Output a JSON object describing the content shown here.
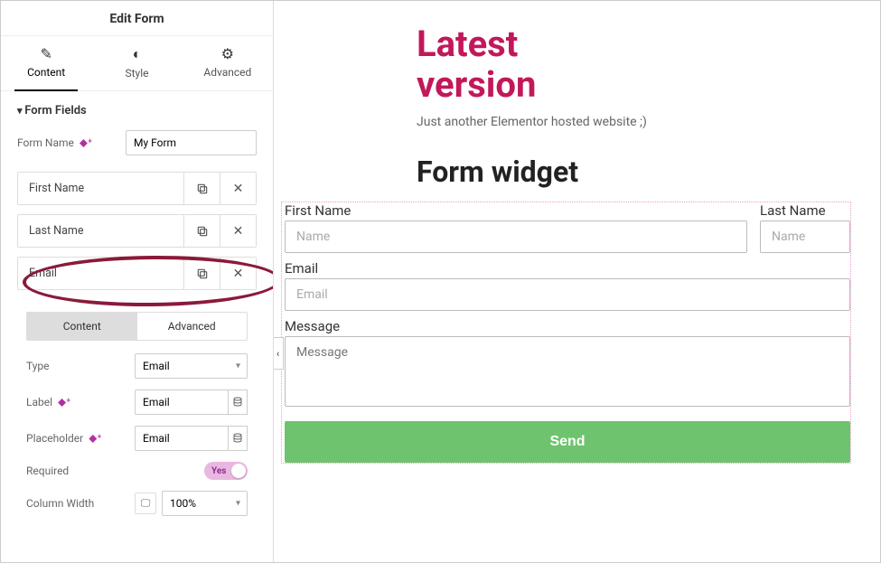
{
  "sidebar": {
    "title": "Edit Form",
    "tabs": [
      {
        "label": "Content",
        "icon": "pencil"
      },
      {
        "label": "Style",
        "icon": "half-circle"
      },
      {
        "label": "Advanced",
        "icon": "gear"
      }
    ],
    "section_title": "Form Fields",
    "form_name_label": "Form Name",
    "form_name_value": "My Form",
    "fields": [
      {
        "label": "First Name"
      },
      {
        "label": "Last Name"
      },
      {
        "label": "Email"
      }
    ],
    "editor": {
      "subtabs": {
        "content": "Content",
        "advanced": "Advanced"
      },
      "type_label": "Type",
      "type_value": "Email",
      "label_label": "Label",
      "label_value": "Email",
      "placeholder_label": "Placeholder",
      "placeholder_value": "Email",
      "required_label": "Required",
      "required_value": "Yes",
      "colwidth_label": "Column Width",
      "colwidth_value": "100%"
    }
  },
  "preview": {
    "hero_title_1": "Latest",
    "hero_title_2": "version",
    "hero_sub": "Just another Elementor hosted website ;)",
    "form_heading": "Form widget",
    "fields": {
      "fn_label": "First Name",
      "fn_ph": "Name",
      "ln_label": "Last Name",
      "ln_ph": "Name",
      "em_label": "Email",
      "em_ph": "Email",
      "msg_label": "Message",
      "msg_ph": "Message"
    },
    "send": "Send"
  }
}
